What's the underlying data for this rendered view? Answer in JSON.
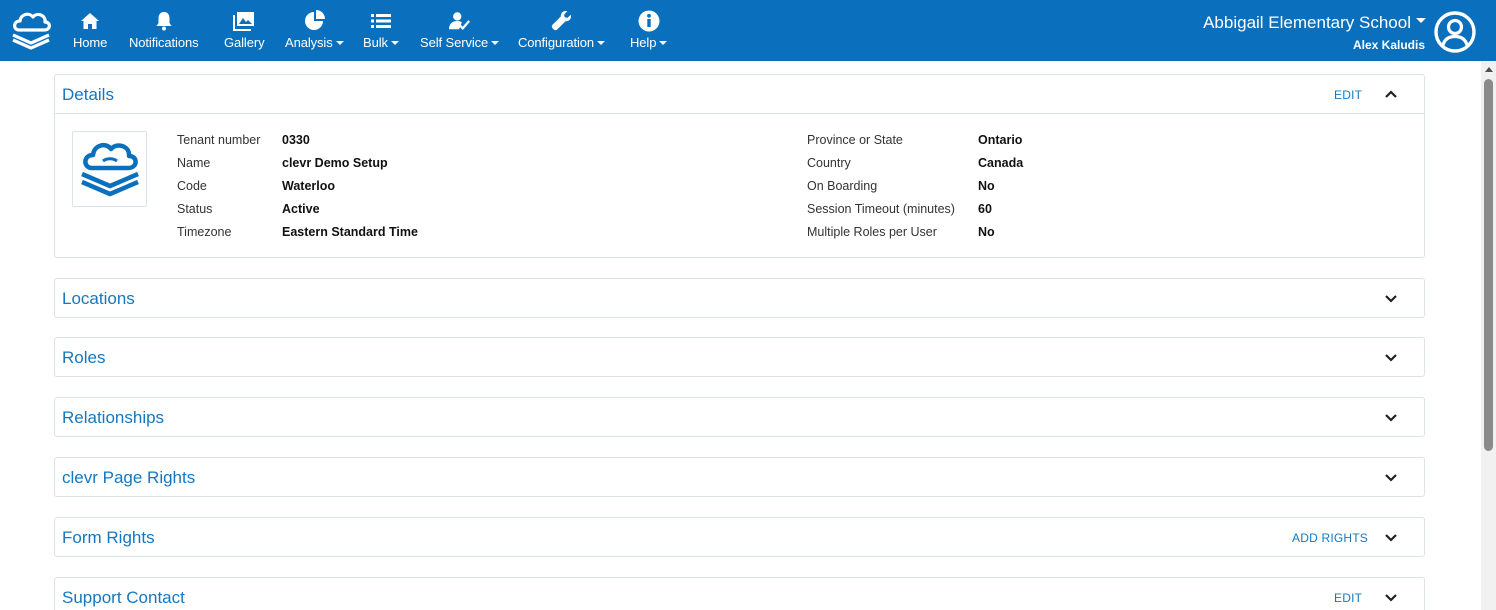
{
  "colors": {
    "navbar": "#0a70bd",
    "link": "#1578bf",
    "border": "#dde2e6"
  },
  "nav": {
    "logo_icon": "clevr-cloud-logo-icon",
    "items": [
      {
        "label": "Home",
        "icon": "home-icon",
        "dropdown": false
      },
      {
        "label": "Notifications",
        "icon": "bell-icon",
        "dropdown": false
      },
      {
        "label": "Gallery",
        "icon": "image-icon",
        "dropdown": false
      },
      {
        "label": "Analysis",
        "icon": "pie-chart-icon",
        "dropdown": true
      },
      {
        "label": "Bulk",
        "icon": "list-icon",
        "dropdown": true
      },
      {
        "label": "Self Service",
        "icon": "user-check-icon",
        "dropdown": true
      },
      {
        "label": "Configuration",
        "icon": "wrench-icon",
        "dropdown": true
      },
      {
        "label": "Help",
        "icon": "info-icon",
        "dropdown": true
      }
    ],
    "school": "Abbigail Elementary School",
    "user": "Alex Kaludis",
    "avatar_icon": "user-circle-icon"
  },
  "details": {
    "title": "Details",
    "action": "EDIT",
    "left_fields": [
      {
        "label": "Tenant number",
        "value": "0330"
      },
      {
        "label": "Name",
        "value": "clevr Demo Setup"
      },
      {
        "label": "Code",
        "value": "Waterloo"
      },
      {
        "label": "Status",
        "value": "Active"
      },
      {
        "label": "Timezone",
        "value": "Eastern Standard Time"
      }
    ],
    "right_fields": [
      {
        "label": "Province or State",
        "value": "Ontario"
      },
      {
        "label": "Country",
        "value": "Canada"
      },
      {
        "label": "On Boarding",
        "value": "No"
      },
      {
        "label": "Session Timeout (minutes)",
        "value": "60"
      },
      {
        "label": "Multiple Roles per User",
        "value": "No"
      }
    ]
  },
  "sections": [
    {
      "title": "Locations",
      "action": ""
    },
    {
      "title": "Roles",
      "action": ""
    },
    {
      "title": "Relationships",
      "action": ""
    },
    {
      "title": "clevr Page Rights",
      "action": ""
    },
    {
      "title": "Form Rights",
      "action": "ADD RIGHTS"
    },
    {
      "title": "Support Contact",
      "action": "EDIT"
    }
  ]
}
